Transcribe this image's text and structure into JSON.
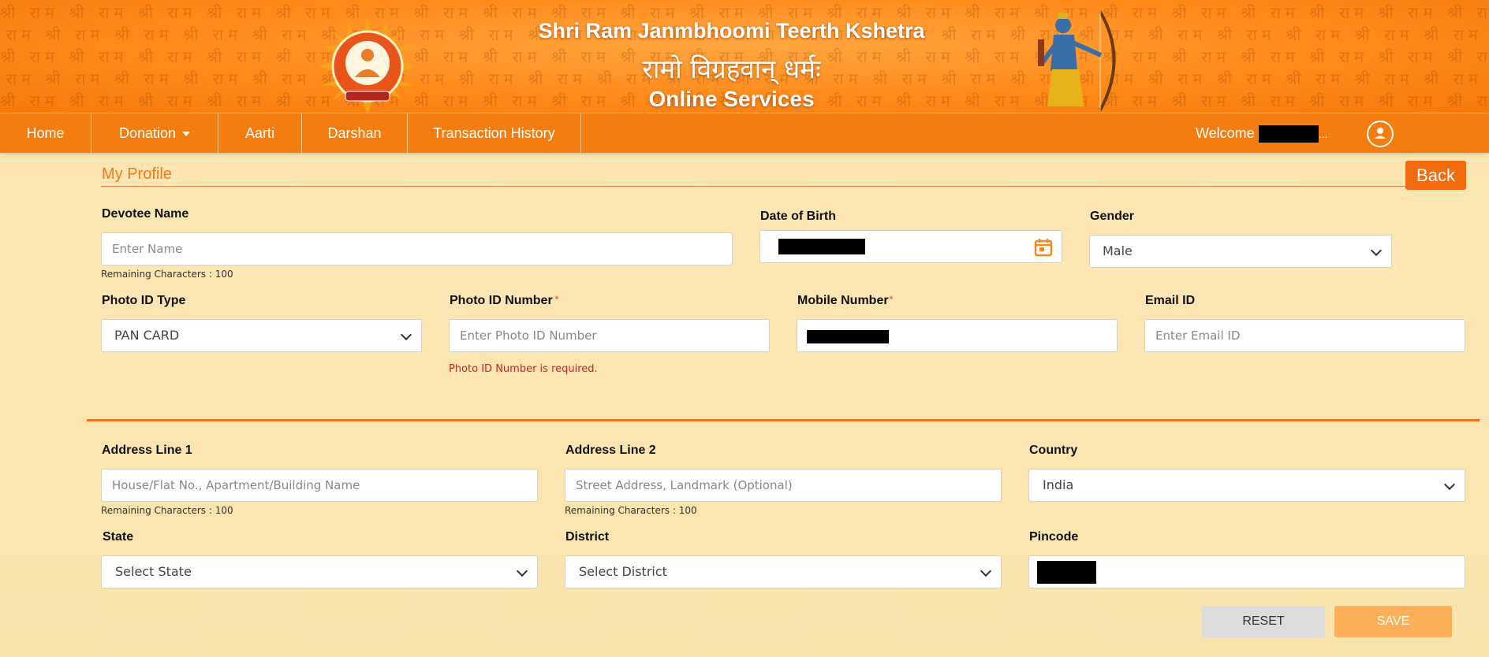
{
  "header": {
    "title_en": "Shri Ram Janmbhoomi Teerth Kshetra",
    "title_hi": "रामो विग्रहवान् धर्मः",
    "subtitle": "Online Services",
    "watermark_text": "श्री राम"
  },
  "nav": {
    "items": [
      {
        "label": "Home"
      },
      {
        "label": "Donation",
        "has_dropdown": true
      },
      {
        "label": "Aarti"
      },
      {
        "label": "Darshan"
      },
      {
        "label": "Transaction History"
      }
    ],
    "welcome_label": "Welcome",
    "welcome_suffix": "...",
    "avatar_icon": "user-circle-icon"
  },
  "page": {
    "section_title": "My Profile",
    "back_label": "Back"
  },
  "form": {
    "devotee_name": {
      "label": "Devotee Name",
      "placeholder": "Enter Name",
      "value": "",
      "hint": "Remaining Characters : 100"
    },
    "dob": {
      "label": "Date of Birth",
      "value": "[redacted]",
      "icon": "calendar-icon"
    },
    "gender": {
      "label": "Gender",
      "value": "Male"
    },
    "photo_id_type": {
      "label": "Photo ID Type",
      "value": "PAN CARD"
    },
    "photo_id_number": {
      "label": "Photo ID Number",
      "required_mark": "*",
      "placeholder": "Enter Photo ID Number",
      "value": "",
      "error": "Photo ID Number is required."
    },
    "mobile": {
      "label": "Mobile Number",
      "required_mark": "*",
      "value": "[redacted]"
    },
    "email": {
      "label": "Email ID",
      "placeholder": "Enter Email ID",
      "value": ""
    },
    "address1": {
      "label": "Address Line 1",
      "placeholder": "House/Flat No., Apartment/Building Name",
      "value": "",
      "hint": "Remaining Characters : 100"
    },
    "address2": {
      "label": "Address Line 2",
      "placeholder": "Street Address, Landmark (Optional)",
      "value": "",
      "hint": "Remaining Characters : 100"
    },
    "country": {
      "label": "Country",
      "value": "India"
    },
    "state": {
      "label": "State",
      "value": "Select State"
    },
    "district": {
      "label": "District",
      "value": "Select District"
    },
    "pincode": {
      "label": "Pincode",
      "value": "[redacted]"
    }
  },
  "actions": {
    "reset_label": "RESET",
    "save_label": "SAVE"
  },
  "colors": {
    "brand_orange": "#f57d0f",
    "accent_orange": "#f07420",
    "error_red": "#c62828",
    "save_button": "#fbb057"
  }
}
